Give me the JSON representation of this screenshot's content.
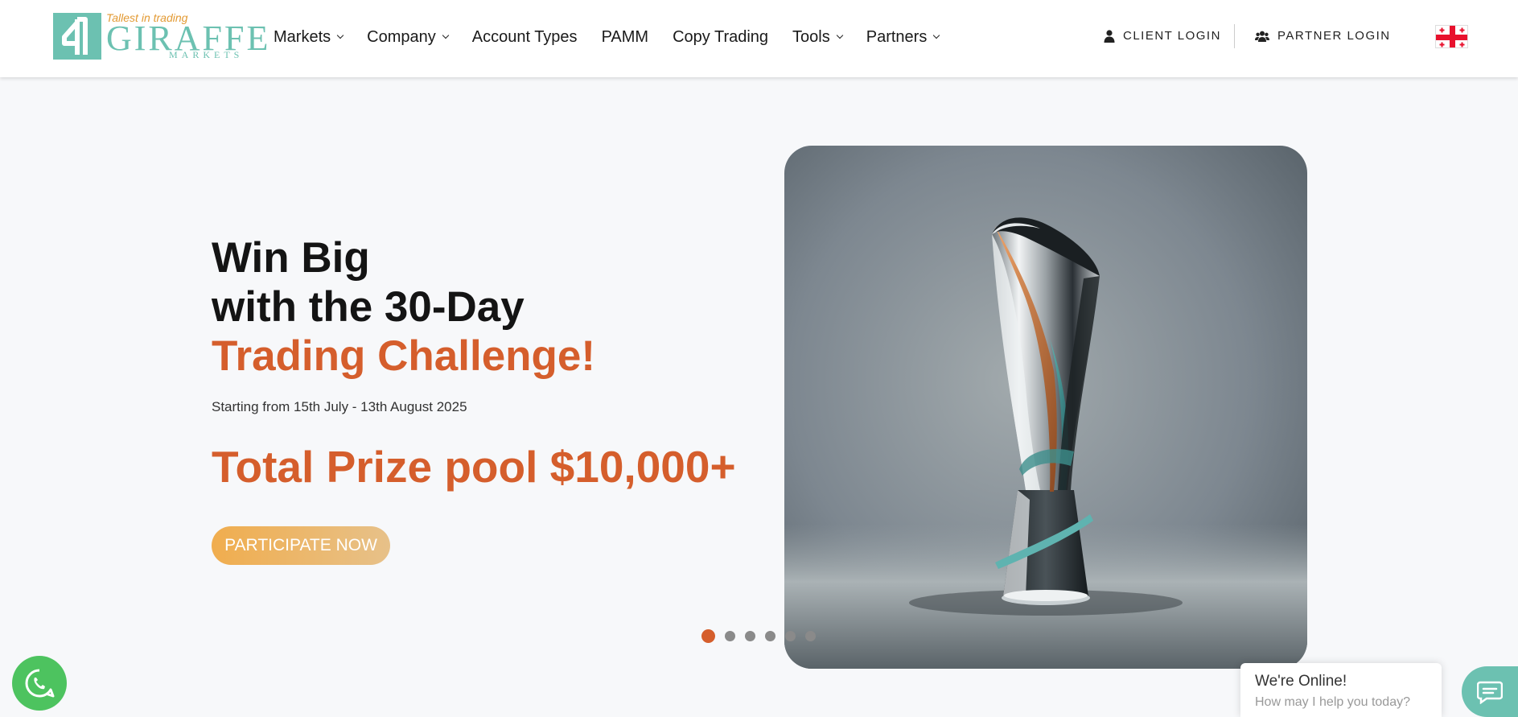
{
  "brand": {
    "tagline": "Tallest in trading",
    "name": "GIRAFFE",
    "sub": "MARKETS"
  },
  "nav": {
    "items": [
      {
        "label": "Markets",
        "dropdown": true
      },
      {
        "label": "Company",
        "dropdown": true
      },
      {
        "label": "Account Types",
        "dropdown": false
      },
      {
        "label": "PAMM",
        "dropdown": false
      },
      {
        "label": "Copy Trading",
        "dropdown": false
      },
      {
        "label": "Tools",
        "dropdown": true
      },
      {
        "label": "Partners",
        "dropdown": true
      }
    ]
  },
  "auth": {
    "client_login": "CLIENT LOGIN",
    "partner_login": "PARTNER LOGIN"
  },
  "hero": {
    "line1": "Win Big",
    "line2": "with the 30-Day",
    "line3": "Trading Challenge!",
    "dates": "Starting from 15th July - 13th August 2025",
    "prize": "Total Prize pool $10,000+",
    "cta": "PARTICIPATE NOW"
  },
  "carousel": {
    "slide_count": 6,
    "active_index": 0
  },
  "chat": {
    "title": "We're Online!",
    "subtitle": "How may I help you today?"
  },
  "colors": {
    "accent": "#d55e2c",
    "brand_teal": "#6cc1b1",
    "cta_start": "#f0ad4e",
    "whatsapp": "#4dc35f"
  },
  "icons": {
    "client_login": "user-icon",
    "partner_login": "users-icon",
    "language": "georgia-flag-icon",
    "whatsapp": "whatsapp-icon",
    "chat": "chat-bubble-icon"
  }
}
